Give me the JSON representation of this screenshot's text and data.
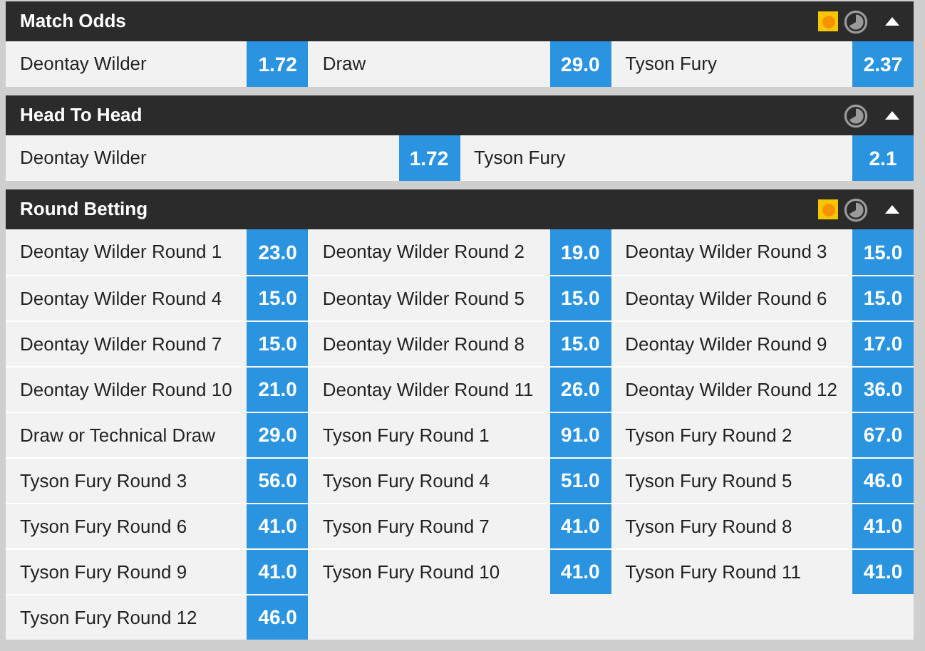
{
  "markets": [
    {
      "title": "Match Odds",
      "cash_out": true,
      "selections": [
        {
          "name": "Deontay Wilder",
          "odds": "1.72"
        },
        {
          "name": "Draw",
          "odds": "29.0"
        },
        {
          "name": "Tyson Fury",
          "odds": "2.37"
        }
      ]
    },
    {
      "title": "Head To Head",
      "cash_out": false,
      "selections": [
        {
          "name": "Deontay Wilder",
          "odds": "1.72"
        },
        {
          "name": "Tyson Fury",
          "odds": "2.1"
        }
      ]
    },
    {
      "title": "Round Betting",
      "cash_out": true,
      "selections": [
        {
          "name": "Deontay Wilder Round 1",
          "odds": "23.0"
        },
        {
          "name": "Deontay Wilder Round 2",
          "odds": "19.0"
        },
        {
          "name": "Deontay Wilder Round 3",
          "odds": "15.0"
        },
        {
          "name": "Deontay Wilder Round 4",
          "odds": "15.0"
        },
        {
          "name": "Deontay Wilder Round 5",
          "odds": "15.0"
        },
        {
          "name": "Deontay Wilder Round 6",
          "odds": "15.0"
        },
        {
          "name": "Deontay Wilder Round 7",
          "odds": "15.0"
        },
        {
          "name": "Deontay Wilder Round 8",
          "odds": "15.0"
        },
        {
          "name": "Deontay Wilder Round 9",
          "odds": "17.0"
        },
        {
          "name": "Deontay Wilder Round 10",
          "odds": "21.0"
        },
        {
          "name": "Deontay Wilder Round 11",
          "odds": "26.0"
        },
        {
          "name": "Deontay Wilder Round 12",
          "odds": "36.0"
        },
        {
          "name": "Draw or Technical Draw",
          "odds": "29.0"
        },
        {
          "name": "Tyson Fury Round 1",
          "odds": "91.0"
        },
        {
          "name": "Tyson Fury Round 2",
          "odds": "67.0"
        },
        {
          "name": "Tyson Fury Round 3",
          "odds": "56.0"
        },
        {
          "name": "Tyson Fury Round 4",
          "odds": "51.0"
        },
        {
          "name": "Tyson Fury Round 5",
          "odds": "46.0"
        },
        {
          "name": "Tyson Fury Round 6",
          "odds": "41.0"
        },
        {
          "name": "Tyson Fury Round 7",
          "odds": "41.0"
        },
        {
          "name": "Tyson Fury Round 8",
          "odds": "41.0"
        },
        {
          "name": "Tyson Fury Round 9",
          "odds": "41.0"
        },
        {
          "name": "Tyson Fury Round 10",
          "odds": "41.0"
        },
        {
          "name": "Tyson Fury Round 11",
          "odds": "41.0"
        },
        {
          "name": "Tyson Fury Round 12",
          "odds": "46.0"
        }
      ]
    }
  ]
}
